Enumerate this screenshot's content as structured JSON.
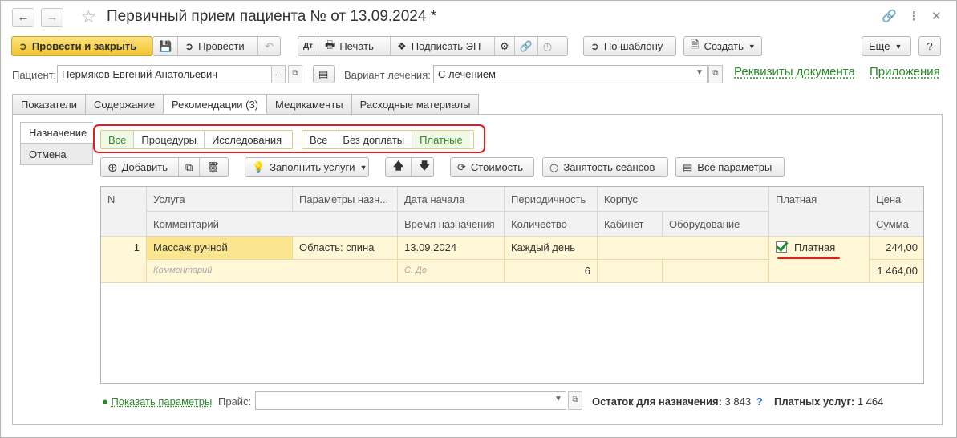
{
  "window": {
    "title": "Первичный прием пациента №  от 13.09.2024 *"
  },
  "toolbar": {
    "post_close": "Провести и закрыть",
    "post": "Провести",
    "print": "Печать",
    "sign": "Подписать ЭП",
    "by_template": "По шаблону",
    "create": "Создать",
    "more": "Еще",
    "help": "?"
  },
  "form": {
    "patient_label": "Пациент:",
    "patient_value": "Пермяков Евгений Анатольевич",
    "treatment_label": "Вариант лечения:",
    "treatment_value": "С лечением",
    "doc_details_link": "Реквизиты документа",
    "attachments_link": "Приложения"
  },
  "tabs": [
    {
      "label": "Показатели"
    },
    {
      "label": "Содержание"
    },
    {
      "label": "Рекомендации (3)"
    },
    {
      "label": "Медикаменты"
    },
    {
      "label": "Расходные материалы"
    }
  ],
  "side_tabs": [
    {
      "label": "Назначение"
    },
    {
      "label": "Отмена"
    }
  ],
  "filters": {
    "type_group": [
      "Все",
      "Процедуры",
      "Исследования"
    ],
    "pay_group": [
      "Все",
      "Без доплаты",
      "Платные"
    ]
  },
  "table_toolbar": {
    "add": "Добавить",
    "fill": "Заполнить услуги",
    "cost": "Стоимость",
    "sessions": "Занятость сеансов",
    "all_params": "Все параметры"
  },
  "table": {
    "headers": {
      "n": "N",
      "service": "Услуга",
      "comment": "Комментарий",
      "params": "Параметры назн...",
      "start_date": "Дата начала",
      "assign_time": "Время назначения",
      "periodicity": "Периодичность",
      "quantity": "Количество",
      "building": "Корпус",
      "cabinet": "Кабинет",
      "equipment": "Оборудование",
      "paid": "Платная",
      "price": "Цена",
      "sum": "Сумма"
    },
    "rows": [
      {
        "n": "1",
        "service": "Массаж ручной",
        "params": "Область: спина",
        "start_date": "13.09.2024",
        "periodicity": "Каждый день",
        "paid_label": "Платная",
        "price": "244,00",
        "comment_placeholder": "Комментарий",
        "time_placeholder": "С. До",
        "quantity": "6",
        "sum": "1 464,00"
      }
    ]
  },
  "footer": {
    "show_params": "Показать параметры",
    "price_label": "Прайс:",
    "balance_label": "Остаток для назначения:",
    "balance_value": "3 843",
    "question": "?",
    "paid_label": "Платных услуг:",
    "paid_value": "1 464"
  },
  "colors": {
    "accent_yellow": "#f2c530",
    "link_green": "#2a8a2a",
    "highlight_red": "#e01e1e",
    "selected_row": "#fff7d6"
  }
}
